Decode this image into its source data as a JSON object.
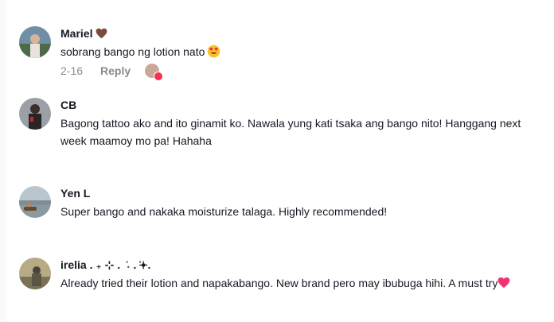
{
  "comments": [
    {
      "author": "Mariel",
      "text": "sobrang bango ng lotion nato",
      "date": "2-16",
      "reply_label": "Reply"
    },
    {
      "author": "CB",
      "text": "Bagong tattoo ako and ito ginamit ko. Nawala yung kati tsaka ang bango nito! Hanggang next week maamoy mo pa! Hahaha"
    },
    {
      "author": "Yen L",
      "text": "Super bango and nakaka moisturize talaga. Highly recommended!"
    },
    {
      "author": "irelia . ₊ ⊹ . ݁ ˖ . ݁𖥔.",
      "text": "Already tried their lotion and napakabango. New brand pero may ibubuga hihi. A must try"
    }
  ],
  "icons": {
    "heart_brown": "#7a4a3a",
    "heart_pink": "#f0336e",
    "emoji_heart_eyes": "smiling-face-with-heart-eyes",
    "reply_badge": "#fe2c55"
  }
}
